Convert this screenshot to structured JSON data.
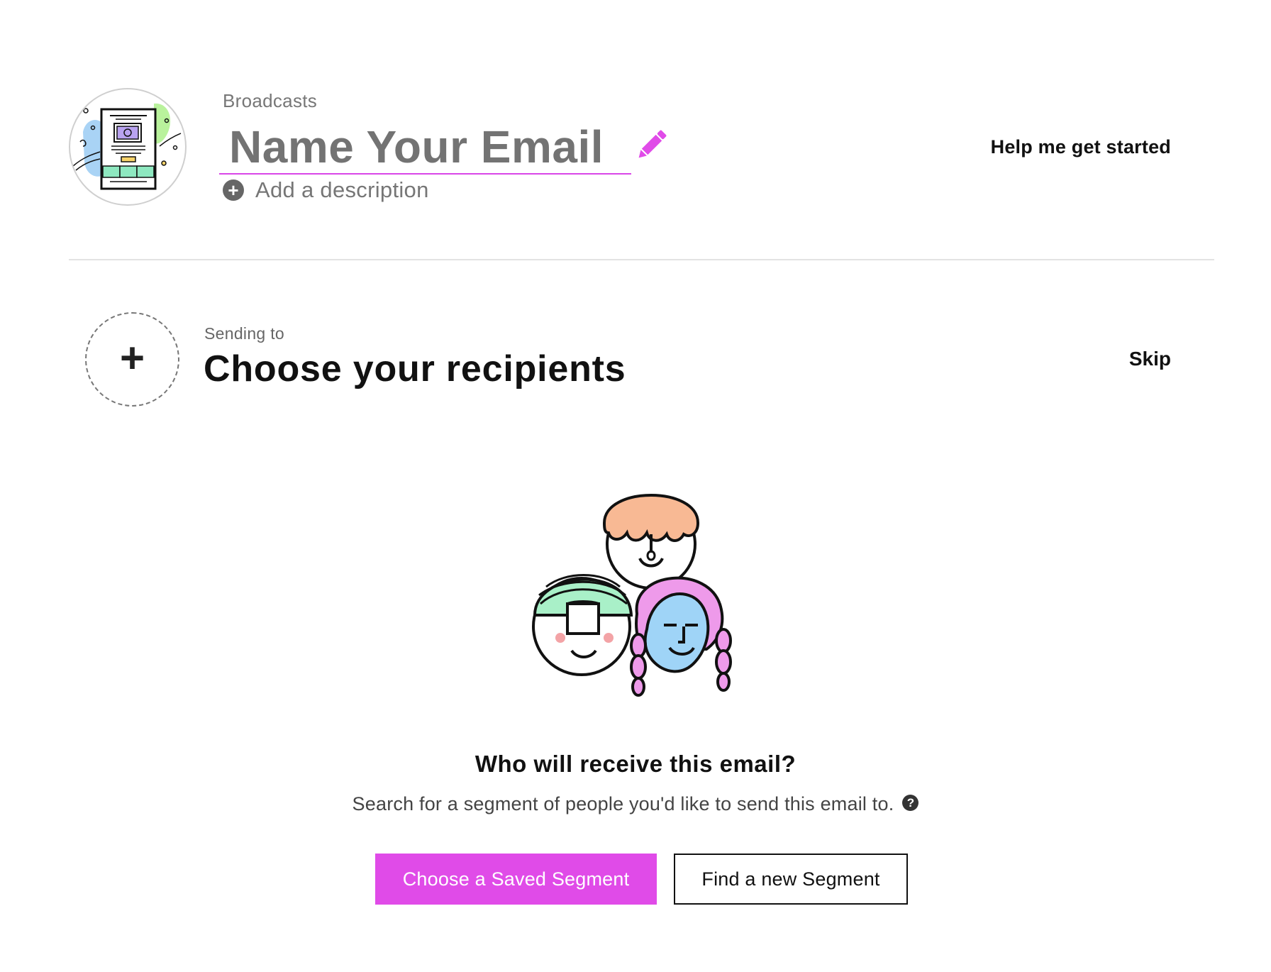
{
  "header": {
    "eyebrow": "Broadcasts",
    "title": "Name Your Email",
    "add_description": "Add a description",
    "help_link": "Help me get started",
    "avatar_icon": "email-template-illustration-icon",
    "edit_icon": "pencil-icon",
    "add_icon": "plus-circle-icon"
  },
  "recipients": {
    "eyebrow": "Sending to",
    "title": "Choose your recipients",
    "skip": "Skip",
    "add_icon": "plus-icon"
  },
  "empty_state": {
    "illustration": "three-faces-illustration",
    "question": "Who will receive this email?",
    "subtext": "Search for a segment of people you'd like to send this email to.",
    "help_icon_text": "?"
  },
  "buttons": {
    "primary": "Choose a Saved Segment",
    "secondary": "Find a new Segment"
  },
  "colors": {
    "accent": "#e04be8",
    "text": "#111111",
    "muted": "#777777",
    "divider": "#e3e3e3"
  }
}
